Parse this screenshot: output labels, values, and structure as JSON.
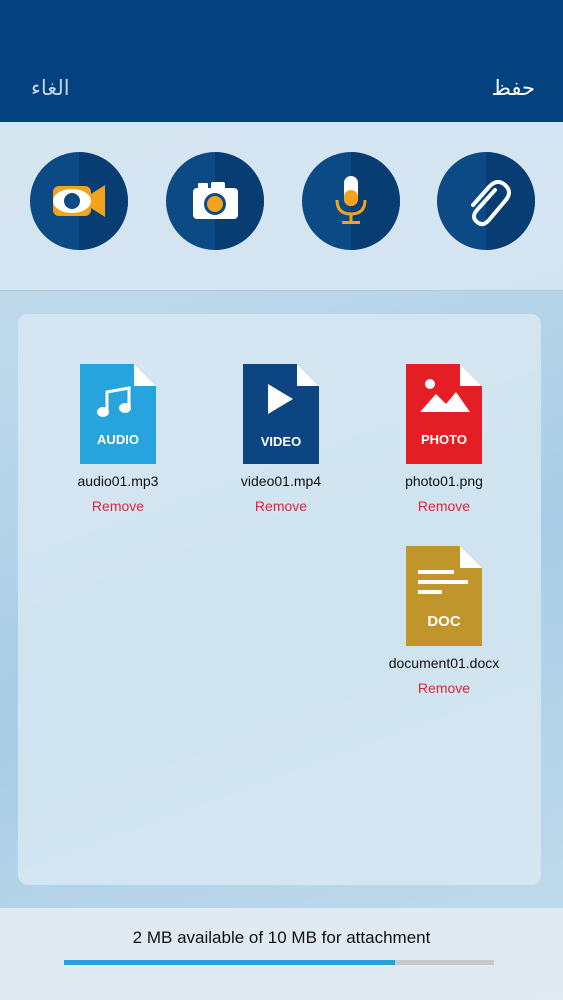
{
  "header": {
    "cancel_label": "الغاء",
    "save_label": "حفظ"
  },
  "media_buttons": [
    {
      "icon": "video-camera-icon",
      "accent": "#f3a41c"
    },
    {
      "icon": "camera-icon",
      "accent": "#f3a41c"
    },
    {
      "icon": "microphone-icon",
      "accent": "#f3a41c"
    },
    {
      "icon": "paperclip-icon",
      "accent": "#ffffff"
    }
  ],
  "attachments": [
    {
      "type_label": "AUDIO",
      "file_name": "audio01.mp3",
      "remove_label": "Remove",
      "color": "#27a4de"
    },
    {
      "type_label": "VIDEO",
      "file_name": "video01.mp4",
      "remove_label": "Remove",
      "color": "#0c4582"
    },
    {
      "type_label": "PHOTO",
      "file_name": "photo01.png",
      "remove_label": "Remove",
      "color": "#e31e24"
    },
    {
      "type_label": "DOC",
      "file_name": "document01.docx",
      "remove_label": "Remove",
      "color": "#c0962c"
    }
  ],
  "footer": {
    "quota_text": "2 MB available of 10 MB for attachment",
    "used_fraction": 0.77
  },
  "colors": {
    "header_bg": "#04427f",
    "button_bg": "#0c4a86",
    "remove_text": "#d9263b",
    "progress_fill": "#2a9fd8"
  }
}
